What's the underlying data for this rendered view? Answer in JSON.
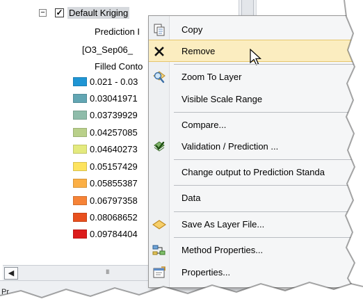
{
  "toc": {
    "layer_name": "Default Kriging",
    "sublabels": [
      "Prediction I",
      "[O3_Sep06_",
      "Filled Conto"
    ],
    "legend": [
      {
        "label": "0.021 - 0.03",
        "color": "#1f95d4"
      },
      {
        "label": "0.03041971",
        "color": "#62a6b3"
      },
      {
        "label": "0.03739929",
        "color": "#8fbcaa"
      },
      {
        "label": "0.04257085",
        "color": "#b9d08a"
      },
      {
        "label": "0.04640273",
        "color": "#e4ea7e"
      },
      {
        "label": "0.05157429",
        "color": "#fde35e"
      },
      {
        "label": "0.05855387",
        "color": "#fbaf45"
      },
      {
        "label": "0.06797358",
        "color": "#f68337"
      },
      {
        "label": "0.08068652",
        "color": "#e8501e"
      },
      {
        "label": "0.09784404",
        "color": "#dc1c1c"
      }
    ],
    "hscroll_grip": "III",
    "status_text": "Pr"
  },
  "menu": {
    "items": [
      {
        "label": "Copy",
        "icon": "copy-icon"
      },
      {
        "label": "Remove",
        "icon": "remove-x-icon"
      },
      {
        "label": "Zoom To Layer",
        "icon": "zoom-to-layer-icon"
      },
      {
        "label": "Visible Scale Range",
        "icon": ""
      },
      {
        "label": "Compare...",
        "icon": ""
      },
      {
        "label": "Validation / Prediction ...",
        "icon": "validation-check-icon"
      },
      {
        "label": "Change output to Prediction Standa",
        "icon": ""
      },
      {
        "label": "Data",
        "icon": ""
      },
      {
        "label": "Save As Layer File...",
        "icon": "layer-file-icon"
      },
      {
        "label": "Method Properties...",
        "icon": "method-properties-icon"
      },
      {
        "label": "Properties...",
        "icon": "properties-icon"
      }
    ],
    "highlighted_item": "Remove"
  },
  "colors": {
    "highlight": "#fbedc0",
    "highlight_border": "#e6c66c",
    "menu_bg": "#f5f6f7"
  }
}
